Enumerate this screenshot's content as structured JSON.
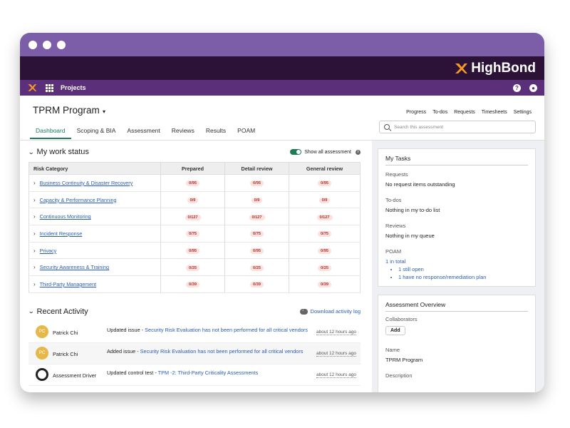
{
  "brand": {
    "name": "HighBond"
  },
  "topnav": {
    "projects_label": "Projects",
    "help_glyph": "?",
    "user_glyph": "●"
  },
  "header": {
    "title": "TPRM Program",
    "links": [
      "Progress",
      "To-dos",
      "Requests",
      "Timesheets",
      "Settings"
    ],
    "tabs": [
      "Dashboard",
      "Scoping & BIA",
      "Assessment",
      "Reviews",
      "Results",
      "POAM"
    ],
    "active_tab": "Dashboard",
    "search_placeholder": "Search this assessment"
  },
  "work_status": {
    "title": "My work status",
    "toggle_label": "Show all assessment",
    "toggle_on": true,
    "columns": [
      "Risk Category",
      "Prepared",
      "Detail review",
      "General review"
    ],
    "rows": [
      {
        "category": "Business Continuity & Disaster Recovery",
        "prepared": "0/95",
        "detail": "0/95",
        "general": "0/95"
      },
      {
        "category": "Capacity & Performance Planning",
        "prepared": "0/9",
        "detail": "0/9",
        "general": "0/9"
      },
      {
        "category": "Continuous Monitoring",
        "prepared": "0/127",
        "detail": "0/127",
        "general": "0/127"
      },
      {
        "category": "Incident Response",
        "prepared": "0/75",
        "detail": "0/75",
        "general": "0/75"
      },
      {
        "category": "Privacy",
        "prepared": "0/95",
        "detail": "0/95",
        "general": "0/95"
      },
      {
        "category": "Security Awareness & Training",
        "prepared": "0/25",
        "detail": "0/25",
        "general": "0/25"
      },
      {
        "category": "Third-Party Management",
        "prepared": "0/39",
        "detail": "0/39",
        "general": "0/39"
      }
    ]
  },
  "recent_activity": {
    "title": "Recent Activity",
    "download_label": "Download activity log",
    "items": [
      {
        "initials": "PC",
        "name": "Patrick Chi",
        "action": "Updated issue - ",
        "link": "Security Risk Evaluation has not been performed for all critical vendors",
        "time": "about 12 hours ago"
      },
      {
        "initials": "PC",
        "name": "Patrick Chi",
        "action": "Added issue - ",
        "link": "Security Risk Evaluation has not been performed for all critical vendors",
        "time": "about 12 hours ago"
      },
      {
        "initials": "",
        "name": "Assessment Driver",
        "action": "Updated control test - ",
        "link": "TPM -2: Third-Party Criticality Assessments",
        "time": "about 12 hours ago"
      }
    ]
  },
  "my_tasks": {
    "title": "My Tasks",
    "requests_label": "Requests",
    "requests_value": "No request items outstanding",
    "todos_label": "To-dos",
    "todos_value": "Nothing in my to-do list",
    "reviews_label": "Reviews",
    "reviews_value": "Nothing in my queue",
    "poam_label": "POAM",
    "poam_total": "1 in total",
    "poam_items": [
      "1 still open",
      "1 have no response/remediation plan"
    ]
  },
  "overview": {
    "title": "Assessment Overview",
    "collaborators_label": "Collaborators",
    "add_label": "Add",
    "name_label": "Name",
    "name_value": "TPRM Program",
    "description_label": "Description"
  },
  "colors": {
    "chrome": "#7b5ea7",
    "brandbar": "#2d1238",
    "nav": "#5c2f7a",
    "accent": "#1c7c55",
    "link": "#2a5db0"
  }
}
